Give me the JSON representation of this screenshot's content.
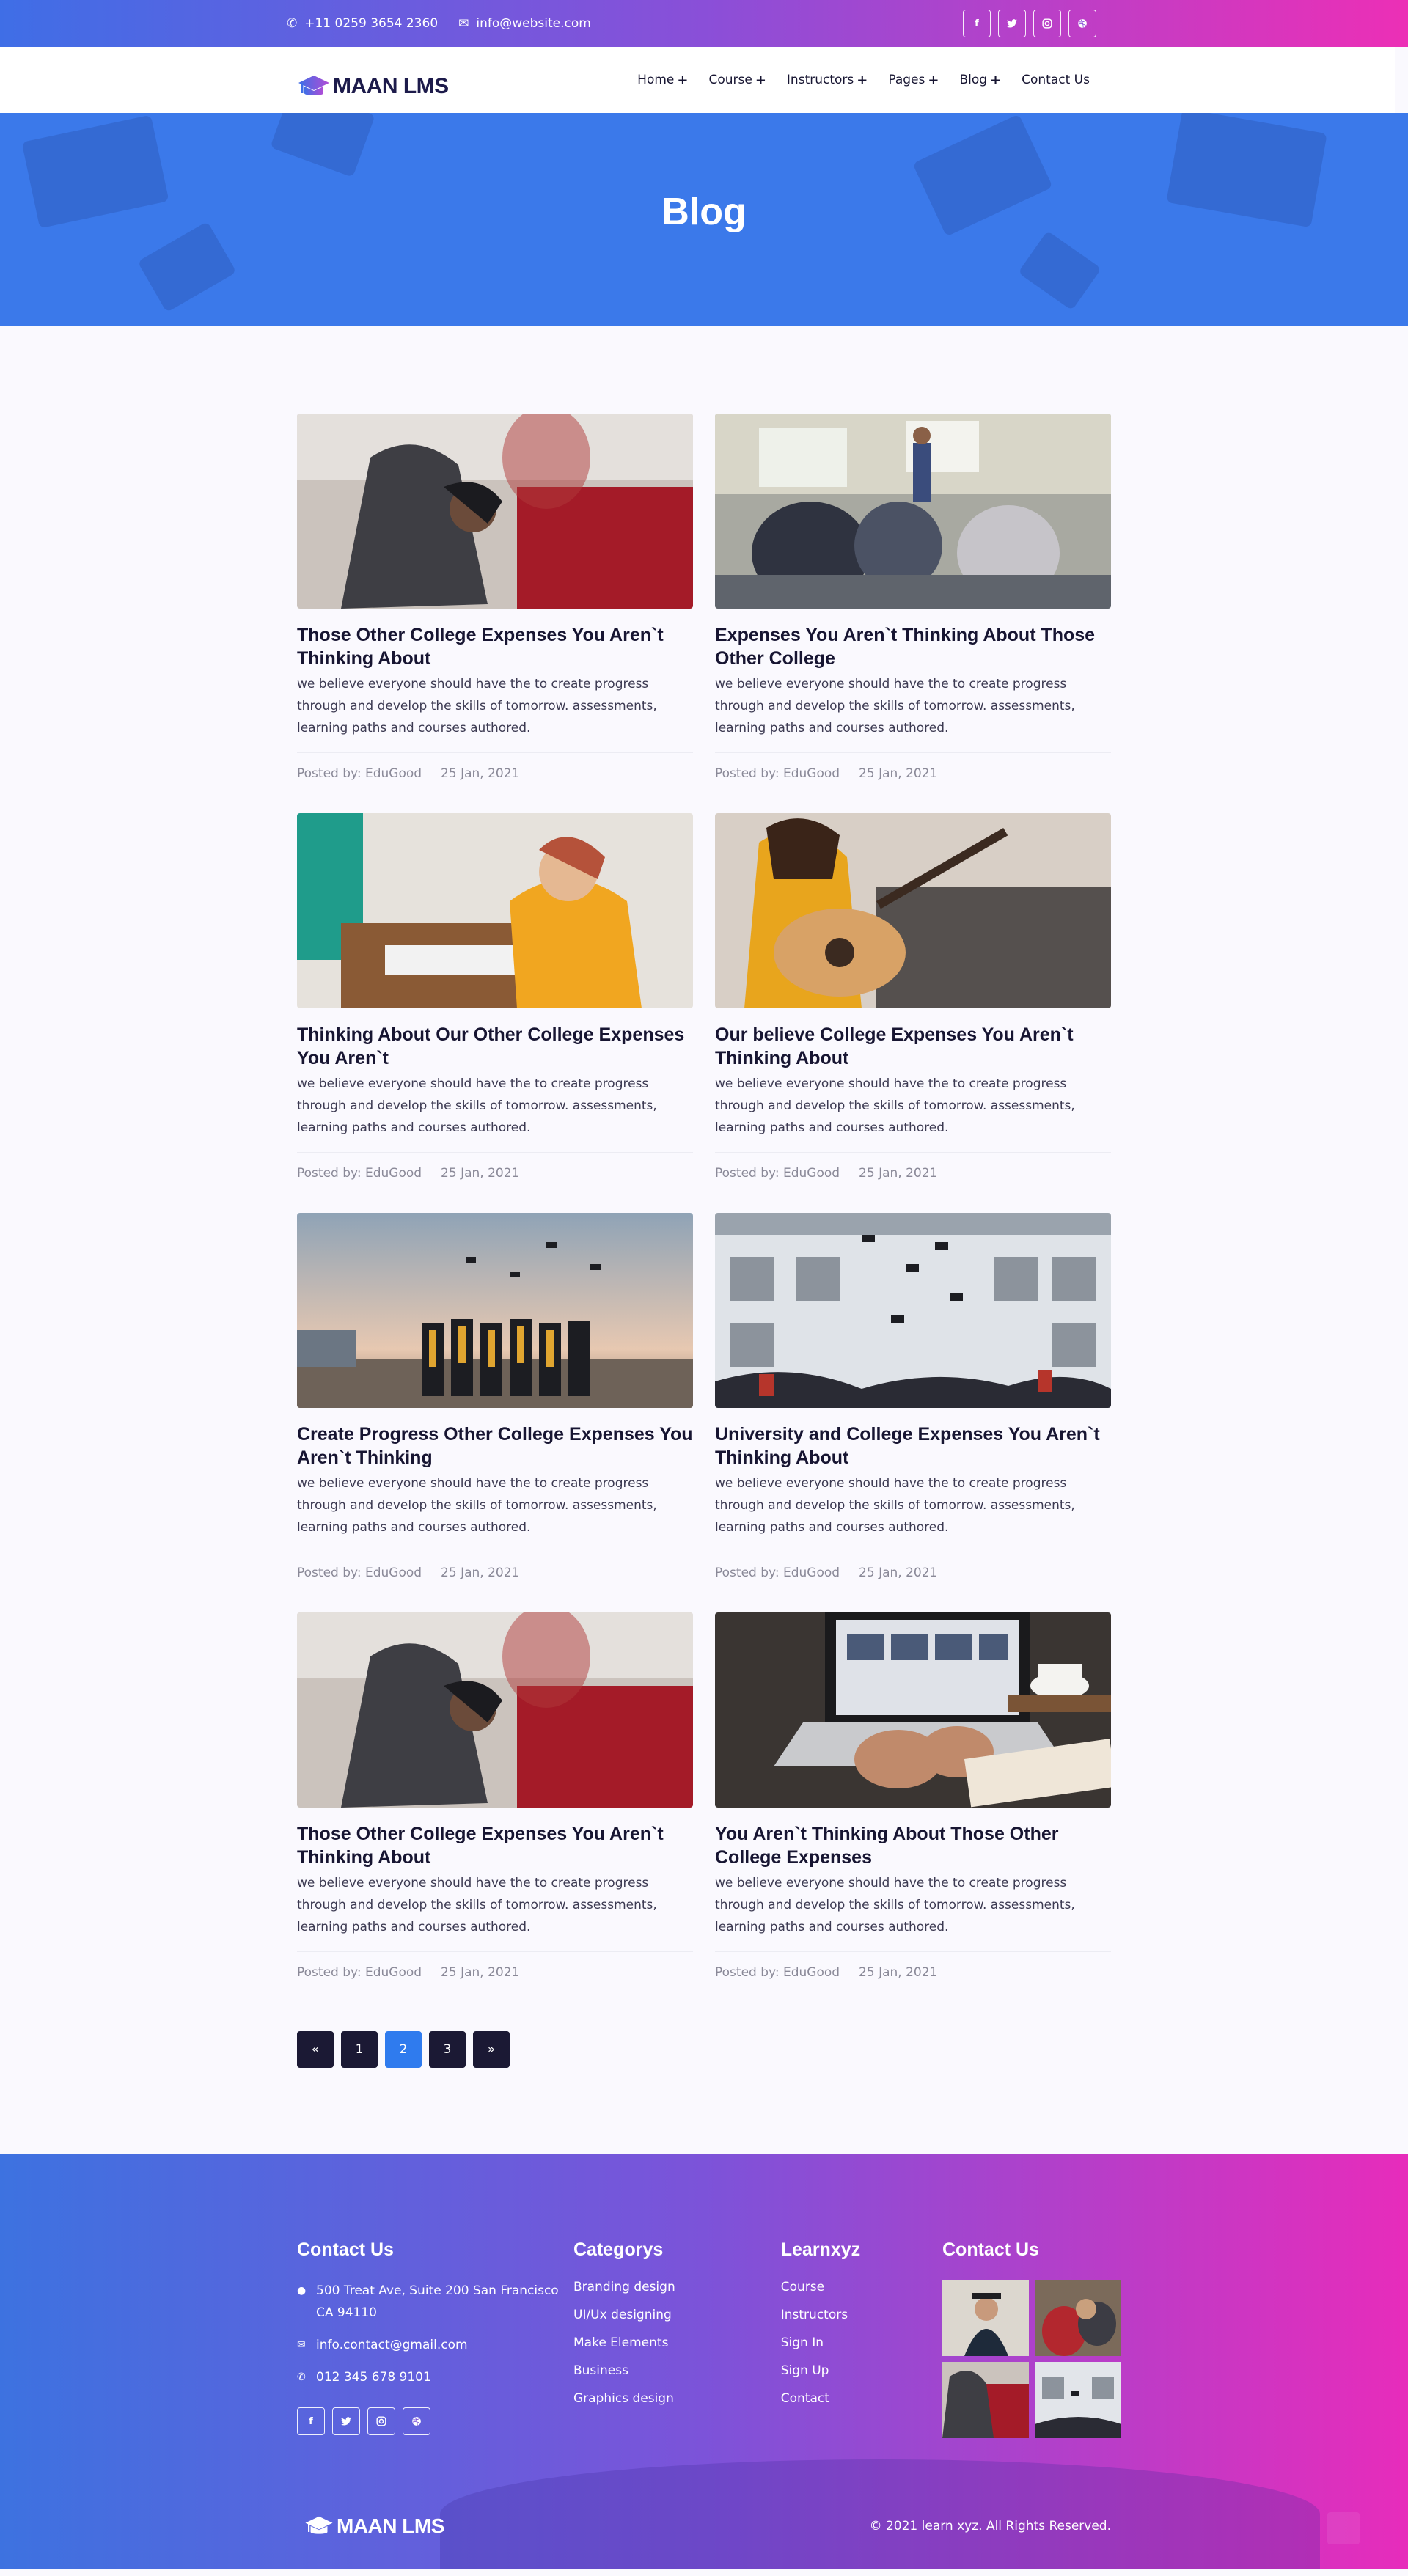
{
  "topbar": {
    "phone": "+11 0259 3654 2360",
    "email": "info@website.com",
    "socials": [
      "facebook-icon",
      "twitter-icon",
      "instagram-icon",
      "dribbble-icon"
    ]
  },
  "nav": {
    "logo_text": "MAAN LMS",
    "items": [
      {
        "label": "Home",
        "plus": "+"
      },
      {
        "label": "Course",
        "plus": "+"
      },
      {
        "label": "Instructors",
        "plus": "+"
      },
      {
        "label": "Pages",
        "plus": "+"
      },
      {
        "label": "Blog",
        "plus": "+"
      },
      {
        "label": "Contact Us",
        "plus": ""
      }
    ]
  },
  "hero": {
    "title": "Blog"
  },
  "posts": [
    {
      "title": "Those Other College Expenses You Aren`t Thinking About",
      "excerpt": "we believe everyone should have the to create progress through and develop the skills of tomorrow. assessments, learning paths and courses authored.",
      "author": "Posted by: EduGood",
      "date": "25 Jan, 2021",
      "image": "student-with-pen"
    },
    {
      "title": "Expenses You Aren`t Thinking About Those Other College",
      "excerpt": "we believe everyone should have the to create progress through and develop the skills of tomorrow. assessments, learning paths and courses authored.",
      "author": "Posted by: EduGood",
      "date": "25 Jan, 2021",
      "image": "classroom"
    },
    {
      "title": "Thinking About Our Other College Expenses You Aren`t",
      "excerpt": "we believe everyone should have the to create progress through and develop the skills of tomorrow. assessments, learning paths and courses authored.",
      "author": "Posted by: EduGood",
      "date": "25 Jan, 2021",
      "image": "woman-at-computer"
    },
    {
      "title": "Our believe College Expenses You Aren`t Thinking About",
      "excerpt": "we believe everyone should have the to create progress through and develop the skills of tomorrow. assessments, learning paths and courses authored.",
      "author": "Posted by: EduGood",
      "date": "25 Jan, 2021",
      "image": "woman-with-guitar"
    },
    {
      "title": "Create Progress Other College Expenses You Aren`t Thinking",
      "excerpt": "we believe everyone should have the to create progress through and develop the skills of tomorrow. assessments, learning paths and courses authored.",
      "author": "Posted by: EduGood",
      "date": "25 Jan, 2021",
      "image": "graduates-sky"
    },
    {
      "title": "University and College Expenses You Aren`t Thinking About",
      "excerpt": "we believe everyone should have the to create progress through and develop the skills of tomorrow. assessments, learning paths and courses authored.",
      "author": "Posted by: EduGood",
      "date": "25 Jan, 2021",
      "image": "caps-thrown-building"
    },
    {
      "title": "Those Other College Expenses You Aren`t Thinking About",
      "excerpt": "we believe everyone should have the to create progress through and develop the skills of tomorrow. assessments, learning paths and courses authored.",
      "author": "Posted by: EduGood",
      "date": "25 Jan, 2021",
      "image": "student-with-pen"
    },
    {
      "title": "You Aren`t Thinking About Those Other College Expenses",
      "excerpt": "we believe everyone should have the to create progress through and develop the skills of tomorrow. assessments, learning paths and courses authored.",
      "author": "Posted by: EduGood",
      "date": "25 Jan, 2021",
      "image": "laptop-coffee"
    }
  ],
  "pagination": {
    "prev": "«",
    "pages": [
      "1",
      "2",
      "3"
    ],
    "active": "2",
    "next": "»"
  },
  "footer": {
    "contact": {
      "title": "Contact Us",
      "address": "500 Treat Ave, Suite 200 San Francisco CA 94110",
      "email": "info.contact@gmail.com",
      "phone": "012 345 678 9101"
    },
    "categories": {
      "title": "Categorys",
      "items": [
        "Branding design",
        "UI/Ux designing",
        "Make Elements",
        "Business",
        "Graphics design"
      ]
    },
    "learn": {
      "title": "Learnxyz",
      "items": [
        "Course",
        "Instructors",
        "Sign In",
        "Sign Up",
        "Contact"
      ]
    },
    "gallery": {
      "title": "Contact Us"
    },
    "logo_text": "MAAN LMS",
    "copyright": "© 2021 learn xyz. All Rights Reserved."
  },
  "colors": {
    "brand_blue": "#3b79ea",
    "brand_pink": "#ec2fb6",
    "dark": "#1b1934",
    "active_page": "#2f7bee"
  }
}
